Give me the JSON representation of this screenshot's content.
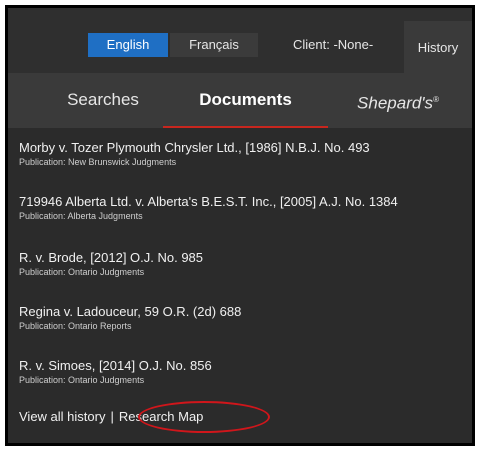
{
  "topbar": {
    "lang_english": "English",
    "lang_french": "Français",
    "client": "Client: -None-",
    "history_label": "History"
  },
  "tabs": {
    "searches": "Searches",
    "documents": "Documents",
    "shepards": "Shepard's",
    "shepards_mark": "®"
  },
  "documents": [
    {
      "title": "Morby v. Tozer Plymouth Chrysler Ltd., [1986] N.B.J. No. 493",
      "publication": "Publication: New Brunswick Judgments"
    },
    {
      "title": "719946 Alberta Ltd. v. Alberta's B.E.S.T. Inc., [2005] A.J. No. 1384",
      "publication": "Publication: Alberta Judgments"
    },
    {
      "title": "R. v. Brode, [2012] O.J. No. 985",
      "publication": "Publication: Ontario Judgments"
    },
    {
      "title": "Regina v. Ladouceur, 59 O.R. (2d) 688",
      "publication": "Publication: Ontario Reports"
    },
    {
      "title": "R. v. Simoes, [2014] O.J. No. 856",
      "publication": "Publication: Ontario Judgments"
    }
  ],
  "footer": {
    "view_all": "View all history",
    "separator": "|",
    "research_map": "Research Map"
  },
  "colors": {
    "accent": "#1f6fc4",
    "underline": "#c8261e",
    "highlight_ellipse": "#d0161b"
  }
}
